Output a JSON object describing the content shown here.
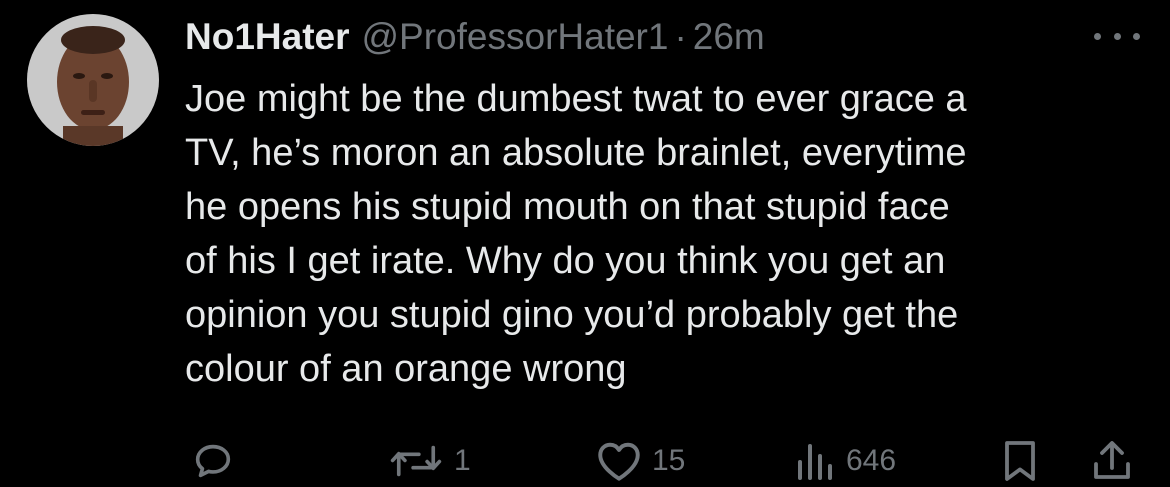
{
  "tweet": {
    "display_name": "No1Hater",
    "handle": "@ProfessorHater1",
    "separator": "·",
    "time": "26m",
    "text": "Joe might be the dumbest twat to ever grace a\nTV, he’s moron an absolute brainlet, everytime\nhe opens his stupid mouth on that stupid face\nof his I get irate. Why do you think you get an\nopinion you stupid gino you’d probably get the\ncolour of an orange wrong"
  },
  "actions": {
    "reply": {
      "icon": "reply-icon",
      "count": ""
    },
    "retweet": {
      "icon": "retweet-icon",
      "count": "1"
    },
    "like": {
      "icon": "heart-icon",
      "count": "15"
    },
    "views": {
      "icon": "views-icon",
      "count": "646"
    },
    "bookmark": {
      "icon": "bookmark-icon"
    },
    "share": {
      "icon": "share-icon"
    }
  },
  "colors": {
    "background": "#000000",
    "text": "#e7e9ea",
    "secondary": "#71767b"
  }
}
